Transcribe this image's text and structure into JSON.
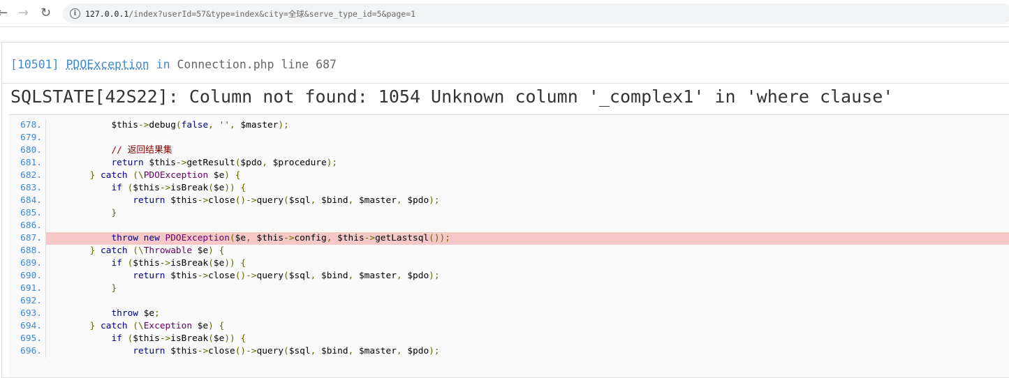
{
  "browser": {
    "url_host": "127.0.0.1",
    "url_rest": "/index?userId=57&type=index&city=全球&serve_type_id=5&page=1"
  },
  "error": {
    "code": "[10501]",
    "class": "PDOException",
    "in": "in",
    "file": "Connection.php line 687",
    "message": "SQLSTATE[42S22]: Column not found: 1054 Unknown column '_complex1' in 'where clause'"
  },
  "highlight_line": "687",
  "lines": [
    {
      "n": "678.",
      "t": [
        [
          "pln",
          "            $this"
        ],
        [
          "pun",
          "->"
        ],
        [
          "pln",
          "debug"
        ],
        [
          "pun",
          "("
        ],
        [
          "kwd",
          "false"
        ],
        [
          "pun",
          ", "
        ],
        [
          "str",
          "''"
        ],
        [
          "pun",
          ", "
        ],
        [
          "pln",
          "$master"
        ],
        [
          "pun",
          ");"
        ]
      ]
    },
    {
      "n": "679.",
      "t": []
    },
    {
      "n": "680.",
      "t": [
        [
          "com",
          "            // 返回结果集"
        ]
      ]
    },
    {
      "n": "681.",
      "t": [
        [
          "kwd",
          "            return "
        ],
        [
          "pln",
          "$this"
        ],
        [
          "pun",
          "->"
        ],
        [
          "pln",
          "getResult"
        ],
        [
          "pun",
          "("
        ],
        [
          "pln",
          "$pdo"
        ],
        [
          "pun",
          ", "
        ],
        [
          "pln",
          "$procedure"
        ],
        [
          "pun",
          ");"
        ]
      ]
    },
    {
      "n": "682.",
      "t": [
        [
          "pun",
          "        } "
        ],
        [
          "kwd",
          "catch "
        ],
        [
          "pun",
          "(\\"
        ],
        [
          "typ",
          "PDOException "
        ],
        [
          "pln",
          "$e"
        ],
        [
          "pun",
          ") {"
        ]
      ]
    },
    {
      "n": "683.",
      "t": [
        [
          "kwd",
          "            if "
        ],
        [
          "pun",
          "("
        ],
        [
          "pln",
          "$this"
        ],
        [
          "pun",
          "->"
        ],
        [
          "pln",
          "isBreak"
        ],
        [
          "pun",
          "("
        ],
        [
          "pln",
          "$e"
        ],
        [
          "pun",
          ")) {"
        ]
      ]
    },
    {
      "n": "684.",
      "t": [
        [
          "kwd",
          "                return "
        ],
        [
          "pln",
          "$this"
        ],
        [
          "pun",
          "->"
        ],
        [
          "pln",
          "close"
        ],
        [
          "pun",
          "()->"
        ],
        [
          "pln",
          "query"
        ],
        [
          "pun",
          "("
        ],
        [
          "pln",
          "$sql"
        ],
        [
          "pun",
          ", "
        ],
        [
          "pln",
          "$bind"
        ],
        [
          "pun",
          ", "
        ],
        [
          "pln",
          "$master"
        ],
        [
          "pun",
          ", "
        ],
        [
          "pln",
          "$pdo"
        ],
        [
          "pun",
          ");"
        ]
      ]
    },
    {
      "n": "685.",
      "t": [
        [
          "pun",
          "            }"
        ]
      ]
    },
    {
      "n": "686.",
      "t": []
    },
    {
      "n": "687.",
      "t": [
        [
          "kwd",
          "            throw new "
        ],
        [
          "typ",
          "PDOException"
        ],
        [
          "pun",
          "("
        ],
        [
          "pln",
          "$e"
        ],
        [
          "pun",
          ", "
        ],
        [
          "pln",
          "$this"
        ],
        [
          "pun",
          "->"
        ],
        [
          "pln",
          "config"
        ],
        [
          "pun",
          ", "
        ],
        [
          "pln",
          "$this"
        ],
        [
          "pun",
          "->"
        ],
        [
          "pln",
          "getLastsql"
        ],
        [
          "pun",
          "());"
        ]
      ]
    },
    {
      "n": "688.",
      "t": [
        [
          "pun",
          "        } "
        ],
        [
          "kwd",
          "catch "
        ],
        [
          "pun",
          "(\\"
        ],
        [
          "typ",
          "Throwable "
        ],
        [
          "pln",
          "$e"
        ],
        [
          "pun",
          ") {"
        ]
      ]
    },
    {
      "n": "689.",
      "t": [
        [
          "kwd",
          "            if "
        ],
        [
          "pun",
          "("
        ],
        [
          "pln",
          "$this"
        ],
        [
          "pun",
          "->"
        ],
        [
          "pln",
          "isBreak"
        ],
        [
          "pun",
          "("
        ],
        [
          "pln",
          "$e"
        ],
        [
          "pun",
          ")) {"
        ]
      ]
    },
    {
      "n": "690.",
      "t": [
        [
          "kwd",
          "                return "
        ],
        [
          "pln",
          "$this"
        ],
        [
          "pun",
          "->"
        ],
        [
          "pln",
          "close"
        ],
        [
          "pun",
          "()->"
        ],
        [
          "pln",
          "query"
        ],
        [
          "pun",
          "("
        ],
        [
          "pln",
          "$sql"
        ],
        [
          "pun",
          ", "
        ],
        [
          "pln",
          "$bind"
        ],
        [
          "pun",
          ", "
        ],
        [
          "pln",
          "$master"
        ],
        [
          "pun",
          ", "
        ],
        [
          "pln",
          "$pdo"
        ],
        [
          "pun",
          ");"
        ]
      ]
    },
    {
      "n": "691.",
      "t": [
        [
          "pun",
          "            }"
        ]
      ]
    },
    {
      "n": "692.",
      "t": []
    },
    {
      "n": "693.",
      "t": [
        [
          "kwd",
          "            throw "
        ],
        [
          "pln",
          "$e"
        ],
        [
          "pun",
          ";"
        ]
      ]
    },
    {
      "n": "694.",
      "t": [
        [
          "pun",
          "        } "
        ],
        [
          "kwd",
          "catch "
        ],
        [
          "pun",
          "(\\"
        ],
        [
          "typ",
          "Exception "
        ],
        [
          "pln",
          "$e"
        ],
        [
          "pun",
          ") {"
        ]
      ]
    },
    {
      "n": "695.",
      "t": [
        [
          "kwd",
          "            if "
        ],
        [
          "pun",
          "("
        ],
        [
          "pln",
          "$this"
        ],
        [
          "pun",
          "->"
        ],
        [
          "pln",
          "isBreak"
        ],
        [
          "pun",
          "("
        ],
        [
          "pln",
          "$e"
        ],
        [
          "pun",
          ")) {"
        ]
      ]
    },
    {
      "n": "696.",
      "t": [
        [
          "kwd",
          "                return "
        ],
        [
          "pln",
          "$this"
        ],
        [
          "pun",
          "->"
        ],
        [
          "pln",
          "close"
        ],
        [
          "pun",
          "()->"
        ],
        [
          "pln",
          "query"
        ],
        [
          "pun",
          "("
        ],
        [
          "pln",
          "$sql"
        ],
        [
          "pun",
          ", "
        ],
        [
          "pln",
          "$bind"
        ],
        [
          "pun",
          ", "
        ],
        [
          "pln",
          "$master"
        ],
        [
          "pun",
          ", "
        ],
        [
          "pln",
          "$pdo"
        ],
        [
          "pun",
          ");"
        ]
      ]
    }
  ]
}
